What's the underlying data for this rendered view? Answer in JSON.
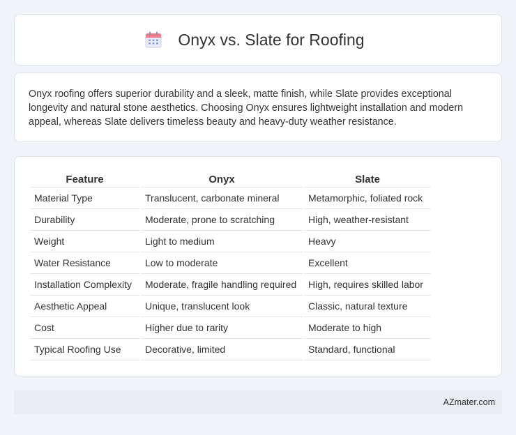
{
  "header": {
    "title": "Onyx vs. Slate for Roofing",
    "icon": "calendar-icon"
  },
  "intro": {
    "text": "Onyx roofing offers superior durability and a sleek, matte finish, while Slate provides exceptional longevity and natural stone aesthetics. Choosing Onyx ensures lightweight installation and modern appeal, whereas Slate delivers timeless beauty and heavy-duty weather resistance."
  },
  "table": {
    "headers": [
      "Feature",
      "Onyx",
      "Slate"
    ],
    "rows": [
      [
        "Material Type",
        "Translucent, carbonate mineral",
        "Metamorphic, foliated rock"
      ],
      [
        "Durability",
        "Moderate, prone to scratching",
        "High, weather-resistant"
      ],
      [
        "Weight",
        "Light to medium",
        "Heavy"
      ],
      [
        "Water Resistance",
        "Low to moderate",
        "Excellent"
      ],
      [
        "Installation Complexity",
        "Moderate, fragile handling required",
        "High, requires skilled labor"
      ],
      [
        "Aesthetic Appeal",
        "Unique, translucent look",
        "Classic, natural texture"
      ],
      [
        "Cost",
        "Higher due to rarity",
        "Moderate to high"
      ],
      [
        "Typical Roofing Use",
        "Decorative, limited",
        "Standard, functional"
      ]
    ]
  },
  "footer": {
    "brand": "AZmater.com"
  }
}
